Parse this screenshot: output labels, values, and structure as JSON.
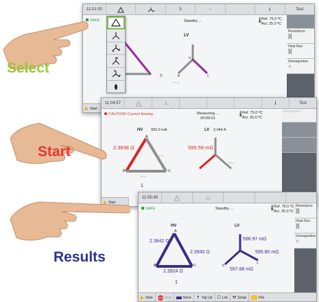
{
  "steps": {
    "select": "Select",
    "start": "Start",
    "results": "Results"
  },
  "screen1": {
    "time": "11:01:00",
    "toolbar": {
      "number": "5",
      "minus": "–",
      "info": "i",
      "test": "Test"
    },
    "status": "SAFE",
    "center": "Standby ...",
    "ref": "Ref.  75.0 ºC",
    "act": "Act.   25.0 ºC",
    "lv": "LV",
    "side": {
      "resistance": "Resistance",
      "heatrun": "Heat Run",
      "demagnetize": "Demagnetize"
    },
    "tap": "1",
    "start": "Start",
    "menu_icons": [
      "delta-triangle-icon",
      "wye-icon",
      "zigzag-icon",
      "wye-variant-icon",
      "zigzag-variant-icon",
      "single-phase-icon"
    ]
  },
  "screen2": {
    "time": "11:04:57",
    "toolbar": {
      "info": "i",
      "test": "Test"
    },
    "status": "CAUTION! Current flowing.",
    "center": "Measuring ...",
    "elapsed": "00:00:01",
    "ref": "Ref.  75.0 ºC",
    "act": "Act.   25.0 ºC",
    "hv": "HV",
    "hv_current": "992.9 mA",
    "lv": "LV",
    "lv_current": "2.044 A",
    "hv_value": "2.3838 Ω",
    "lv_value": "595.59 mΩ",
    "side": {
      "resistance": "Resistance"
    },
    "tap": "1",
    "start": "Start"
  },
  "screen3": {
    "time": "11:05:45",
    "status": "SAFE",
    "center": "Standby ...",
    "ref": "Ref.  75.0 ºC",
    "act": "Act.   25.0 ºC",
    "hv": "HV",
    "lv": "LV",
    "hv_values": [
      "2.3842 Ω",
      "2.3940 Ω",
      "2.3924 Ω"
    ],
    "lv_values": [
      "596.97 mΩ",
      "595.80 mΩ",
      "597.88 mΩ"
    ],
    "side": {
      "resistance": "Resistance",
      "heatrun": "Heat Run",
      "demagnetize": "Demagnetize"
    },
    "tap": "1",
    "bottom": {
      "start": "Start",
      "stop": "Stop",
      "none": "None",
      "list": "List",
      "setup": "Setup",
      "file": "File",
      "tap_up": "Tap Up"
    }
  }
}
